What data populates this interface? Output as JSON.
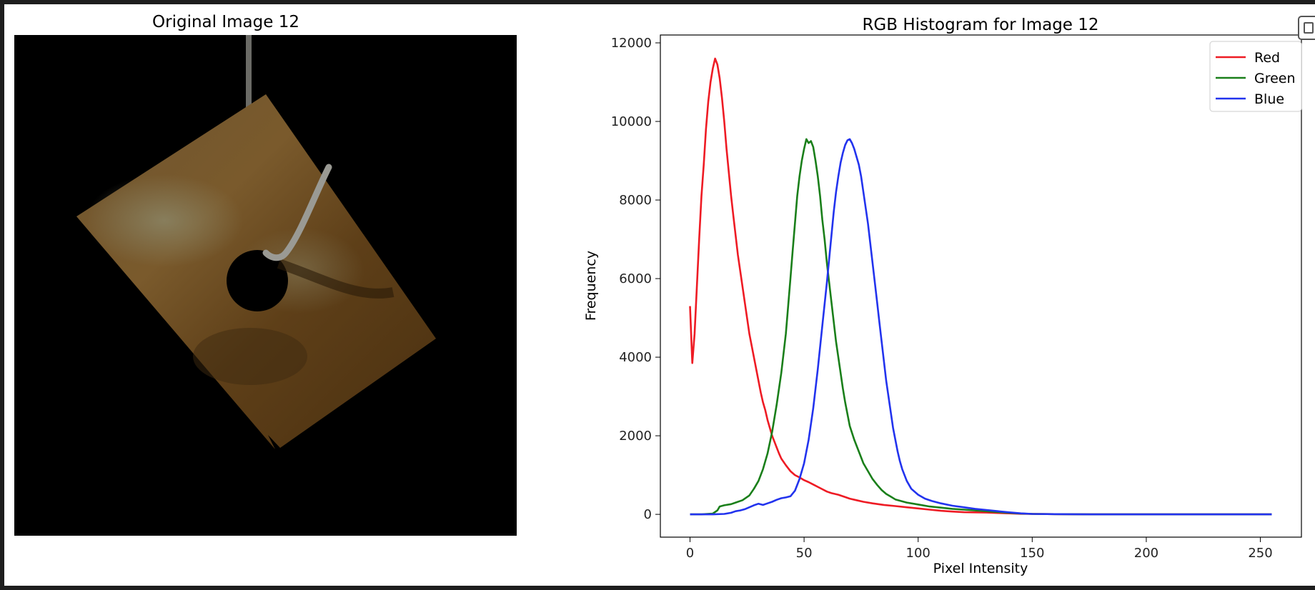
{
  "left_panel": {
    "title": "Original Image 12"
  },
  "colors": {
    "red": "#ee1b24",
    "green": "#1a7f1a",
    "blue": "#2233ee",
    "background": "#ffffff",
    "photo_background": "#000000",
    "plate": "#6b4a1f"
  },
  "icons": {
    "copy": "copy-icon"
  },
  "chart_data": {
    "type": "line",
    "title": "RGB Histogram for Image 12",
    "xlabel": "Pixel Intensity",
    "ylabel": "Frequency",
    "xlim": [
      -13,
      268
    ],
    "ylim": [
      -580,
      12200
    ],
    "xticks": [
      0,
      50,
      100,
      150,
      200,
      250
    ],
    "yticks": [
      0,
      2000,
      4000,
      6000,
      8000,
      10000,
      12000
    ],
    "grid": false,
    "legend": "upper right",
    "series": [
      {
        "name": "Red",
        "color": "#ee1b24",
        "points": [
          [
            0,
            5300
          ],
          [
            1,
            3850
          ],
          [
            2,
            4600
          ],
          [
            3,
            5800
          ],
          [
            4,
            7000
          ],
          [
            5,
            8100
          ],
          [
            6,
            8900
          ],
          [
            7,
            9800
          ],
          [
            8,
            10500
          ],
          [
            9,
            11000
          ],
          [
            10,
            11350
          ],
          [
            11,
            11600
          ],
          [
            12,
            11450
          ],
          [
            13,
            11100
          ],
          [
            14,
            10600
          ],
          [
            15,
            10000
          ],
          [
            16,
            9300
          ],
          [
            17,
            8700
          ],
          [
            18,
            8100
          ],
          [
            19,
            7600
          ],
          [
            20,
            7100
          ],
          [
            21,
            6600
          ],
          [
            22,
            6200
          ],
          [
            23,
            5800
          ],
          [
            24,
            5400
          ],
          [
            25,
            5000
          ],
          [
            26,
            4600
          ],
          [
            27,
            4300
          ],
          [
            28,
            4000
          ],
          [
            29,
            3700
          ],
          [
            30,
            3400
          ],
          [
            31,
            3100
          ],
          [
            32,
            2850
          ],
          [
            33,
            2650
          ],
          [
            34,
            2400
          ],
          [
            35,
            2200
          ],
          [
            36,
            2000
          ],
          [
            37,
            1850
          ],
          [
            38,
            1700
          ],
          [
            39,
            1550
          ],
          [
            40,
            1420
          ],
          [
            42,
            1250
          ],
          [
            44,
            1100
          ],
          [
            46,
            1000
          ],
          [
            48,
            940
          ],
          [
            50,
            870
          ],
          [
            52,
            820
          ],
          [
            54,
            760
          ],
          [
            56,
            700
          ],
          [
            58,
            640
          ],
          [
            60,
            580
          ],
          [
            62,
            540
          ],
          [
            65,
            500
          ],
          [
            68,
            440
          ],
          [
            70,
            400
          ],
          [
            73,
            360
          ],
          [
            76,
            320
          ],
          [
            80,
            280
          ],
          [
            85,
            240
          ],
          [
            90,
            210
          ],
          [
            95,
            180
          ],
          [
            100,
            150
          ],
          [
            105,
            120
          ],
          [
            110,
            90
          ],
          [
            115,
            70
          ],
          [
            120,
            55
          ],
          [
            125,
            50
          ],
          [
            130,
            45
          ],
          [
            135,
            35
          ],
          [
            140,
            25
          ],
          [
            145,
            15
          ],
          [
            150,
            10
          ],
          [
            160,
            5
          ],
          [
            180,
            0
          ],
          [
            200,
            0
          ],
          [
            230,
            0
          ],
          [
            255,
            0
          ]
        ]
      },
      {
        "name": "Green",
        "color": "#1a7f1a",
        "points": [
          [
            0,
            0
          ],
          [
            5,
            0
          ],
          [
            10,
            20
          ],
          [
            12,
            100
          ],
          [
            13,
            200
          ],
          [
            15,
            230
          ],
          [
            18,
            260
          ],
          [
            20,
            300
          ],
          [
            23,
            360
          ],
          [
            26,
            480
          ],
          [
            28,
            650
          ],
          [
            30,
            850
          ],
          [
            32,
            1150
          ],
          [
            34,
            1550
          ],
          [
            36,
            2100
          ],
          [
            38,
            2800
          ],
          [
            40,
            3600
          ],
          [
            42,
            4600
          ],
          [
            43,
            5300
          ],
          [
            44,
            6000
          ],
          [
            45,
            6700
          ],
          [
            46,
            7400
          ],
          [
            47,
            8100
          ],
          [
            48,
            8600
          ],
          [
            49,
            9000
          ],
          [
            50,
            9300
          ],
          [
            51,
            9550
          ],
          [
            52,
            9450
          ],
          [
            53,
            9500
          ],
          [
            54,
            9350
          ],
          [
            55,
            9000
          ],
          [
            56,
            8600
          ],
          [
            57,
            8100
          ],
          [
            58,
            7500
          ],
          [
            59,
            7000
          ],
          [
            60,
            6400
          ],
          [
            61,
            5900
          ],
          [
            62,
            5400
          ],
          [
            63,
            4900
          ],
          [
            64,
            4400
          ],
          [
            65,
            4000
          ],
          [
            66,
            3600
          ],
          [
            67,
            3200
          ],
          [
            68,
            2850
          ],
          [
            69,
            2550
          ],
          [
            70,
            2250
          ],
          [
            72,
            1900
          ],
          [
            74,
            1600
          ],
          [
            76,
            1300
          ],
          [
            78,
            1100
          ],
          [
            80,
            900
          ],
          [
            82,
            750
          ],
          [
            84,
            620
          ],
          [
            86,
            520
          ],
          [
            88,
            450
          ],
          [
            90,
            380
          ],
          [
            95,
            300
          ],
          [
            100,
            250
          ],
          [
            105,
            200
          ],
          [
            110,
            170
          ],
          [
            115,
            140
          ],
          [
            120,
            120
          ],
          [
            125,
            100
          ],
          [
            130,
            80
          ],
          [
            135,
            60
          ],
          [
            140,
            40
          ],
          [
            145,
            20
          ],
          [
            150,
            10
          ],
          [
            160,
            5
          ],
          [
            180,
            0
          ],
          [
            200,
            0
          ],
          [
            230,
            0
          ],
          [
            255,
            0
          ]
        ]
      },
      {
        "name": "Blue",
        "color": "#2233ee",
        "points": [
          [
            0,
            0
          ],
          [
            10,
            0
          ],
          [
            15,
            10
          ],
          [
            18,
            40
          ],
          [
            20,
            80
          ],
          [
            22,
            100
          ],
          [
            24,
            130
          ],
          [
            26,
            180
          ],
          [
            28,
            230
          ],
          [
            30,
            270
          ],
          [
            32,
            240
          ],
          [
            34,
            280
          ],
          [
            36,
            320
          ],
          [
            38,
            370
          ],
          [
            40,
            410
          ],
          [
            42,
            430
          ],
          [
            44,
            460
          ],
          [
            46,
            600
          ],
          [
            48,
            900
          ],
          [
            50,
            1300
          ],
          [
            52,
            1900
          ],
          [
            54,
            2700
          ],
          [
            56,
            3700
          ],
          [
            58,
            4800
          ],
          [
            60,
            5900
          ],
          [
            61,
            6500
          ],
          [
            62,
            7100
          ],
          [
            63,
            7700
          ],
          [
            64,
            8200
          ],
          [
            65,
            8600
          ],
          [
            66,
            8950
          ],
          [
            67,
            9200
          ],
          [
            68,
            9400
          ],
          [
            69,
            9520
          ],
          [
            70,
            9550
          ],
          [
            71,
            9450
          ],
          [
            72,
            9300
          ],
          [
            73,
            9100
          ],
          [
            74,
            8900
          ],
          [
            75,
            8600
          ],
          [
            76,
            8200
          ],
          [
            77,
            7800
          ],
          [
            78,
            7400
          ],
          [
            79,
            6900
          ],
          [
            80,
            6400
          ],
          [
            81,
            5900
          ],
          [
            82,
            5400
          ],
          [
            83,
            4900
          ],
          [
            84,
            4400
          ],
          [
            85,
            3900
          ],
          [
            86,
            3400
          ],
          [
            87,
            3000
          ],
          [
            88,
            2600
          ],
          [
            89,
            2200
          ],
          [
            90,
            1900
          ],
          [
            91,
            1600
          ],
          [
            92,
            1350
          ],
          [
            93,
            1150
          ],
          [
            95,
            850
          ],
          [
            97,
            650
          ],
          [
            100,
            500
          ],
          [
            103,
            400
          ],
          [
            106,
            340
          ],
          [
            110,
            280
          ],
          [
            115,
            220
          ],
          [
            120,
            180
          ],
          [
            125,
            140
          ],
          [
            130,
            110
          ],
          [
            135,
            80
          ],
          [
            140,
            50
          ],
          [
            145,
            25
          ],
          [
            150,
            10
          ],
          [
            160,
            5
          ],
          [
            180,
            0
          ],
          [
            200,
            0
          ],
          [
            230,
            0
          ],
          [
            255,
            0
          ]
        ]
      }
    ]
  }
}
